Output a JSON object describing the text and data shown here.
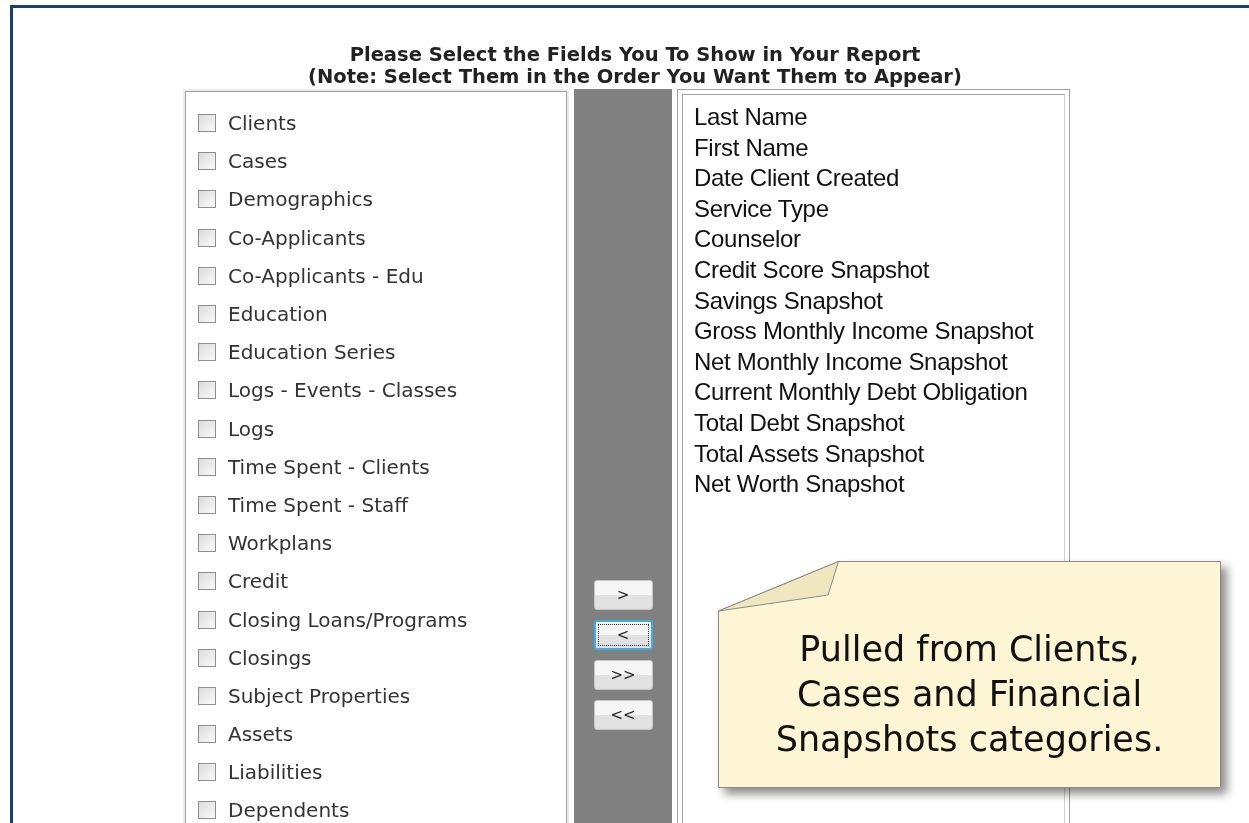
{
  "heading": {
    "line_1": "Please Select the Fields You To Show in Your Report",
    "line_2": "(Note: Select Them in the Order You Want Them to Appear)"
  },
  "fields": [
    {
      "label": "Clients",
      "checked": false
    },
    {
      "label": "Cases",
      "checked": false
    },
    {
      "label": "Demographics",
      "checked": false
    },
    {
      "label": "Co-Applicants",
      "checked": false
    },
    {
      "label": "Co-Applicants - Edu",
      "checked": false
    },
    {
      "label": "Education",
      "checked": false
    },
    {
      "label": "Education Series",
      "checked": false
    },
    {
      "label": "Logs - Events - Classes",
      "checked": false
    },
    {
      "label": "Logs",
      "checked": false
    },
    {
      "label": "Time Spent - Clients",
      "checked": false
    },
    {
      "label": "Time Spent - Staff",
      "checked": false
    },
    {
      "label": "Workplans",
      "checked": false
    },
    {
      "label": "Credit",
      "checked": false
    },
    {
      "label": "Closing Loans/Programs",
      "checked": false
    },
    {
      "label": "Closings",
      "checked": false
    },
    {
      "label": "Subject Properties",
      "checked": false
    },
    {
      "label": "Assets",
      "checked": false
    },
    {
      "label": "Liabilities",
      "checked": false
    },
    {
      "label": "Dependents",
      "checked": false
    }
  ],
  "move_buttons": [
    {
      "label": ">",
      "focused": false
    },
    {
      "label": "<",
      "focused": true
    },
    {
      "label": ">>",
      "focused": false
    },
    {
      "label": "<<",
      "focused": false
    }
  ],
  "selected_fields": [
    "Last Name",
    "First Name",
    "Date Client Created",
    "Service Type",
    "Counselor",
    "Credit Score Snapshot",
    "Savings Snapshot",
    "Gross Monthly Income Snapshot",
    "Net Monthly Income Snapshot",
    "Current Monthly Debt Obligation",
    "Total Debt Snapshot",
    "Total Assets Snapshot",
    "Net Worth Snapshot"
  ],
  "callout": {
    "text": "Pulled from Clients, Cases and Financial Snapshots categories."
  }
}
